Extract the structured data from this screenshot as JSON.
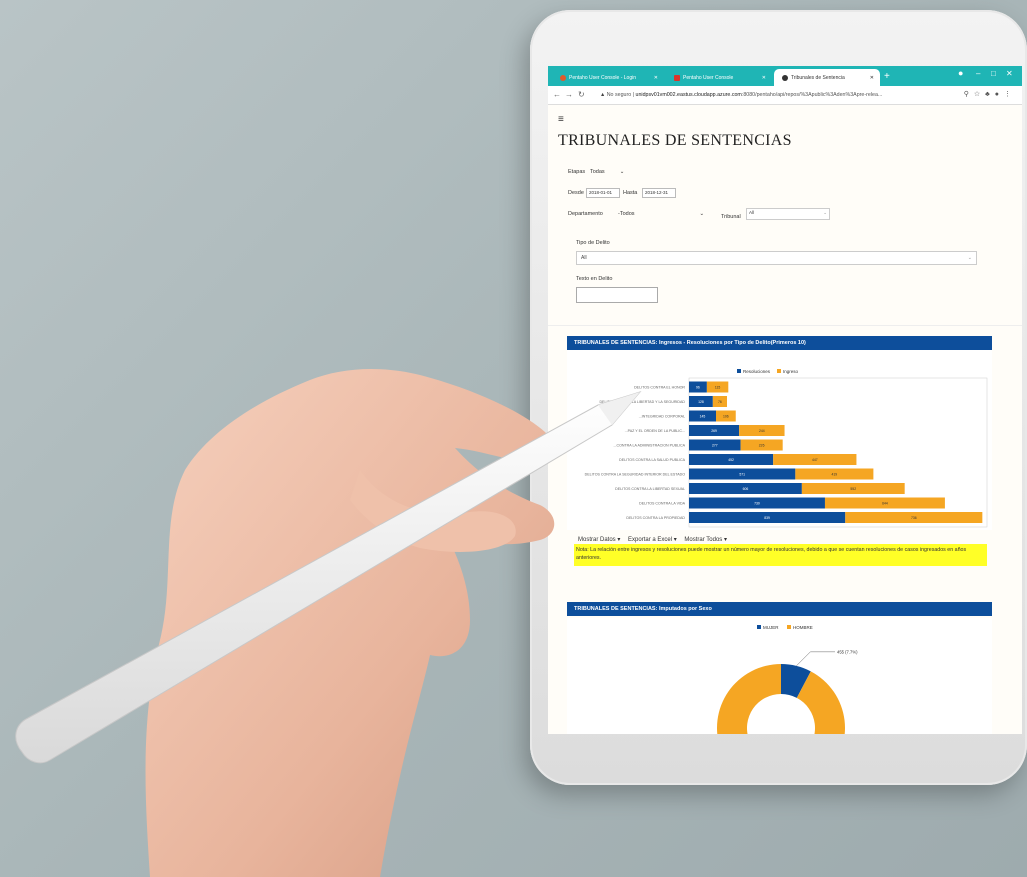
{
  "browser": {
    "tabs": [
      {
        "label": "Pentaho User Console - Login",
        "icon_color": "#e05a2b"
      },
      {
        "label": "Pentaho User Console",
        "icon_color": "#d9352b"
      },
      {
        "label": "Tribunales de Sentencia",
        "icon_color": "#333333"
      }
    ],
    "new_tab": "+",
    "window_controls": [
      "–",
      "□",
      "✕"
    ],
    "security_label": "No seguro",
    "url_host": "unidpsv01vm002.eastus.cloudapp.azure.com",
    "url_rest": ":8080/pentaho/api/repos/%3Apublic%3Aden%3Apre-relea..."
  },
  "page": {
    "title": "TRIBUNALES DE SENTENCIAS",
    "filters": {
      "etapas_label": "Etapas",
      "etapas_value": "Todas",
      "desde_label": "Desde",
      "desde_value": "2018-01-01",
      "hasta_label": "Hasta",
      "hasta_value": "2018-12-31",
      "departamento_label": "Departamento",
      "departamento_value": "-Todos",
      "tribunal_label": "Tribunal",
      "tribunal_value": "All",
      "tipo_label": "Tipo de Delito",
      "tipo_value": "All",
      "texto_label": "Texto en Delito"
    },
    "panel1_title": "TRIBUNALES DE SENTENCIAS: Ingresos - Resoluciones por Tipo de Delito(Primeros 10)",
    "panel1_menus": [
      "Mostrar Datos ▾",
      "Exportar a Excel ▾",
      "Mostrar Todos ▾"
    ],
    "note": "Nota: La relación entre ingresos y resoluciones puede mostrar un número mayor de resoluciones, debido a que se cuentan resoluciones de casos ingresados en años anteriores.",
    "panel2_title": "TRIBUNALES DE SENTENCIAS: Imputados por Sexo"
  },
  "chart_data": [
    {
      "type": "bar",
      "orientation": "horizontal",
      "stacked": true,
      "categories": [
        "DELITOS CONTRA EL HONOR",
        "DELITOS CONTRA LA LIBERTAD Y LA SEGURIDAD",
        "...INTEGRIDAD CORPORAL",
        "...PAZ Y EL ORDEN DE LA PUBLIC...",
        "...CONTRA LA ADMINISTRACION PUBLICA",
        "DELITOS CONTRA LA SALUD PUBLICA",
        "DELITOS CONTRA LA SEGURIDAD INTERIOR DEL ESTADO",
        "DELITOS CONTRA LA LIBERTAD SEXUAL",
        "DELITOS CONTRA LA VIDA",
        "DELITOS CONTRA LA PROPIEDAD"
      ],
      "series": [
        {
          "name": "Resoluciones",
          "color": "#0d4e9b",
          "values": [
            96,
            128,
            145,
            269,
            277,
            452,
            571,
            606,
            730,
            839
          ]
        },
        {
          "name": "Ingreso",
          "color": "#f5a623",
          "values": [
            115,
            76,
            106,
            244,
            226,
            447,
            419,
            552,
            644,
            736
          ]
        }
      ],
      "xlim": [
        0,
        1600
      ],
      "xticks": [
        0,
        200,
        400,
        600,
        800,
        1000,
        1200,
        1400,
        1600
      ],
      "legend": "top-center"
    },
    {
      "type": "pie",
      "donut": true,
      "series_names": [
        "MUJER",
        "HOMBRE"
      ],
      "colors": [
        "#0d4e9b",
        "#f5a623"
      ],
      "values": [
        7.7,
        92.3
      ],
      "annotation": "455 (7.7%)",
      "legend": "top-center"
    }
  ]
}
